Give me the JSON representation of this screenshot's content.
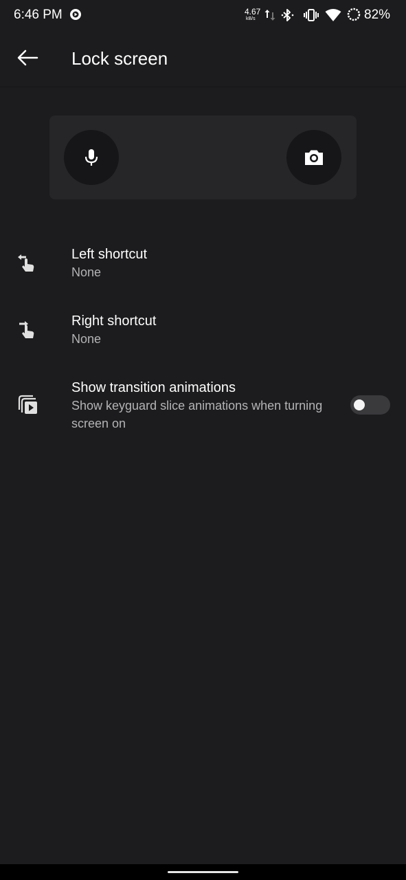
{
  "status_bar": {
    "time": "6:46 PM",
    "net_speed_value": "4.67",
    "net_speed_unit": "kB/s",
    "battery_percent": "82%",
    "icons": [
      "cast-icon",
      "data-arrows-icon",
      "bluetooth-icon",
      "vibrate-icon",
      "wifi-icon",
      "battery-saver-icon"
    ]
  },
  "app_bar": {
    "title": "Lock screen",
    "back_icon": "back-arrow-icon"
  },
  "preview": {
    "left_icon": "microphone-icon",
    "right_icon": "camera-icon"
  },
  "settings": [
    {
      "title": "Left shortcut",
      "summary": "None",
      "icon": "left-shortcut-icon"
    },
    {
      "title": "Right shortcut",
      "summary": "None",
      "icon": "right-shortcut-icon"
    },
    {
      "title": "Show transition animations",
      "summary": "Show keyguard slice animations when turning screen on",
      "icon": "animations-icon",
      "toggle_on": false
    }
  ],
  "colors": {
    "background": "#1c1c1e",
    "preview_card": "#262628",
    "preview_button": "#161618",
    "secondary_text": "#b4b4b6"
  }
}
